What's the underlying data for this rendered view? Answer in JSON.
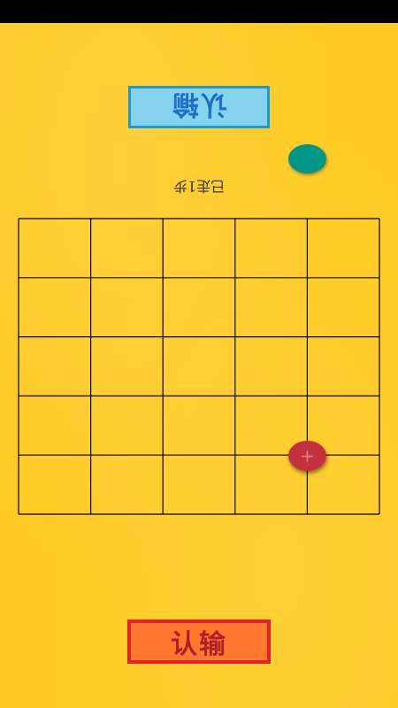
{
  "game": {
    "board": {
      "columns": 5,
      "rows": 5,
      "line_color": "#000000",
      "background_color": "#FFCB24"
    },
    "opponent": {
      "resign_label": "认输",
      "move_counter": "已走1步",
      "button_color": "#86D3EE",
      "button_border_color": "#1C9AD6",
      "piece_color": "#009688"
    },
    "player": {
      "resign_label": "认输",
      "button_color": "#FF7A2E",
      "button_border_color": "#E4212F",
      "piece_color": "#C4313E",
      "piece_symbol": "+"
    }
  }
}
